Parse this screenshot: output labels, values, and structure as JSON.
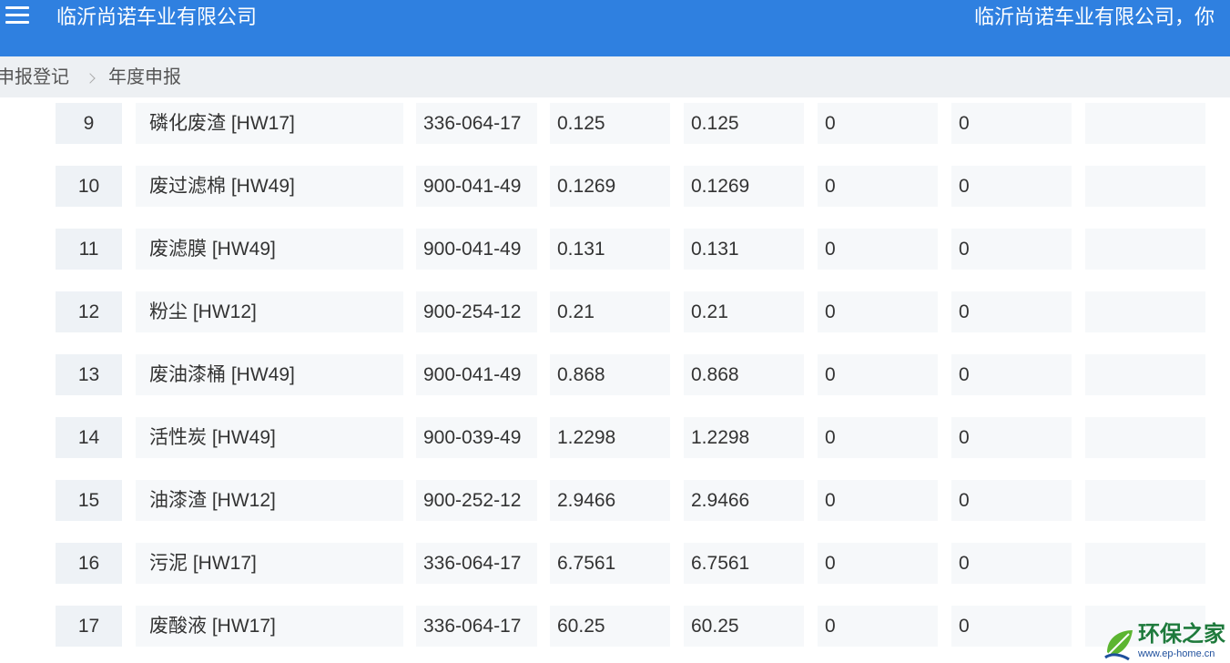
{
  "header": {
    "title": "临沂尚诺车业有限公司",
    "welcome": "临沂尚诺车业有限公司，你"
  },
  "breadcrumb": {
    "items": [
      "申报登记",
      "年度申报"
    ]
  },
  "table": {
    "rows": [
      {
        "index": "9",
        "name": "磷化废渣 [HW17]",
        "code": "336-064-17",
        "v1": "0.125",
        "v2": "0.125",
        "v3": "0",
        "v4": "0",
        "v5": ""
      },
      {
        "index": "10",
        "name": "废过滤棉 [HW49]",
        "code": "900-041-49",
        "v1": "0.1269",
        "v2": "0.1269",
        "v3": "0",
        "v4": "0",
        "v5": ""
      },
      {
        "index": "11",
        "name": "废滤膜 [HW49]",
        "code": "900-041-49",
        "v1": "0.131",
        "v2": "0.131",
        "v3": "0",
        "v4": "0",
        "v5": ""
      },
      {
        "index": "12",
        "name": "粉尘 [HW12]",
        "code": "900-254-12",
        "v1": "0.21",
        "v2": "0.21",
        "v3": "0",
        "v4": "0",
        "v5": ""
      },
      {
        "index": "13",
        "name": "废油漆桶 [HW49]",
        "code": "900-041-49",
        "v1": "0.868",
        "v2": "0.868",
        "v3": "0",
        "v4": "0",
        "v5": ""
      },
      {
        "index": "14",
        "name": "活性炭 [HW49]",
        "code": "900-039-49",
        "v1": "1.2298",
        "v2": "1.2298",
        "v3": "0",
        "v4": "0",
        "v5": ""
      },
      {
        "index": "15",
        "name": "油漆渣 [HW12]",
        "code": "900-252-12",
        "v1": "2.9466",
        "v2": "2.9466",
        "v3": "0",
        "v4": "0",
        "v5": ""
      },
      {
        "index": "16",
        "name": "污泥 [HW17]",
        "code": "336-064-17",
        "v1": "6.7561",
        "v2": "6.7561",
        "v3": "0",
        "v4": "0",
        "v5": ""
      },
      {
        "index": "17",
        "name": "废酸液 [HW17]",
        "code": "336-064-17",
        "v1": "60.25",
        "v2": "60.25",
        "v3": "0",
        "v4": "0",
        "v5": ""
      }
    ]
  },
  "watermark": {
    "name": "环保之家",
    "url": "www.ep-home.cn"
  },
  "colors": {
    "header_bg": "#2f80e0",
    "breadcrumb_bg": "#edf0f3",
    "cell_bg": "#f6f8fa"
  },
  "icons": {
    "menu": "hamburger-menu-icon",
    "separator": "chevron-right-icon",
    "watermark_logo": "leaf-logo-icon"
  }
}
